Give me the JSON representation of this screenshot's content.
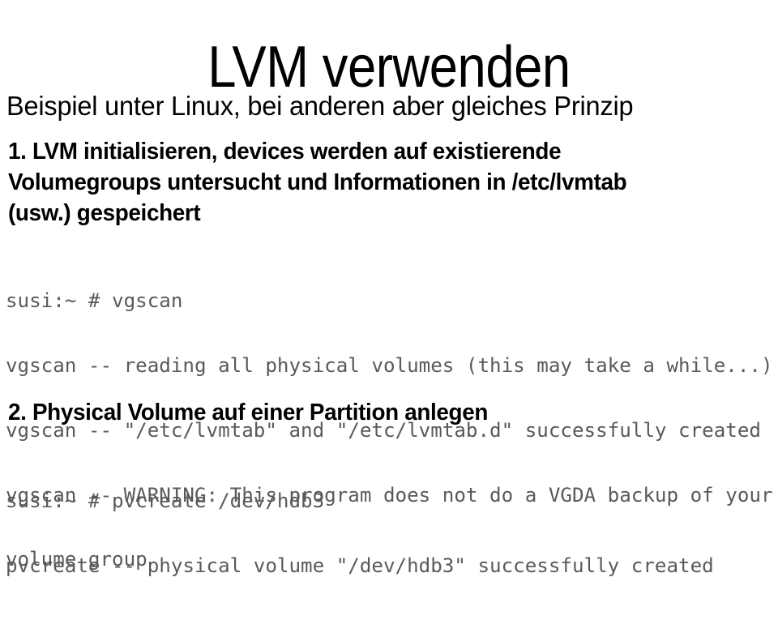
{
  "slide": {
    "title": "LVM verwenden",
    "subtitle": "Beispiel unter Linux, bei anderen aber gleiches Prinzip",
    "background_color": "#ffffff",
    "text_color": "#000000",
    "console_text_color": "#5a5a5a"
  },
  "step_one": {
    "lines": [
      "1. LVM initialisieren, devices werden auf existierende",
      "Volumegroups untersucht und Informationen in /etc/lvmtab",
      "(usw.) gespeichert"
    ]
  },
  "console_one": {
    "lines": [
      "susi:~ # vgscan",
      "vgscan -- reading all physical volumes (this may take a while...)",
      "vgscan -- \"/etc/lvmtab\" and \"/etc/lvmtab.d\" successfully created",
      "vgscan -- WARNING: This program does not do a VGDA backup of your",
      "volume group"
    ]
  },
  "step_two": {
    "lines": [
      "2. Physical Volume auf einer Partition anlegen"
    ]
  },
  "console_two": {
    "lines": [
      "susi:~ # pvcreate /dev/hdb3",
      "pvcreate -- physical volume \"/dev/hdb3\" successfully created"
    ]
  }
}
